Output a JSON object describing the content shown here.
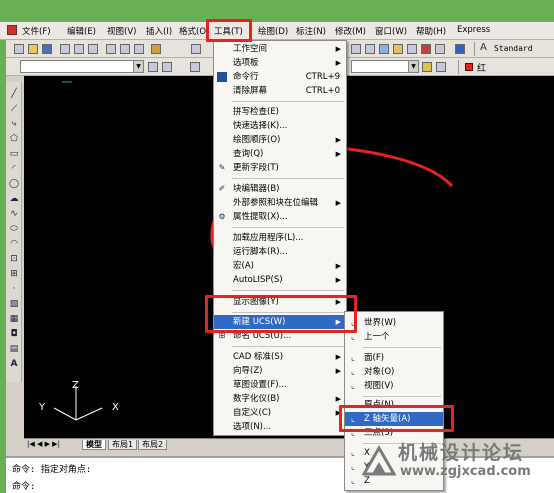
{
  "menubar": {
    "items": [
      {
        "label": "文件(F)"
      },
      {
        "label": "编辑(E)"
      },
      {
        "label": "视图(V)"
      },
      {
        "label": "插入(I)"
      },
      {
        "label": "格式(O)"
      },
      {
        "label": "工具(T)"
      },
      {
        "label": "绘图(D)"
      },
      {
        "label": "标注(N)"
      },
      {
        "label": "修改(M)"
      },
      {
        "label": "窗口(W)"
      },
      {
        "label": "帮助(H)"
      },
      {
        "label": "Express"
      }
    ]
  },
  "toolbar": {
    "style_name": "Standard",
    "layer_name": "红"
  },
  "tools_menu": {
    "items": [
      {
        "label": "工作空间",
        "sub": "▶"
      },
      {
        "label": "选项板",
        "sub": "▶"
      },
      {
        "label": "命令行",
        "shortcut": "CTRL+9"
      },
      {
        "label": "清除屏幕",
        "shortcut": "CTRL+0"
      },
      {
        "label": "拼写检查(E)"
      },
      {
        "label": "快速选择(K)..."
      },
      {
        "label": "绘图顺序(O)",
        "sub": "▶"
      },
      {
        "label": "查询(Q)",
        "sub": "▶"
      },
      {
        "label": "更新字段(T)"
      },
      {
        "label": "块编辑器(B)"
      },
      {
        "label": "外部参照和块在位编辑",
        "sub": "▶"
      },
      {
        "label": "属性提取(X)..."
      },
      {
        "label": "加载应用程序(L)..."
      },
      {
        "label": "运行脚本(R)..."
      },
      {
        "label": "宏(A)",
        "sub": "▶"
      },
      {
        "label": "AutoLISP(S)",
        "sub": "▶"
      },
      {
        "label": "显示图像(Y)",
        "sub": "▶"
      },
      {
        "label": "新建 UCS(W)",
        "sub": "▶"
      },
      {
        "label": "命名 UCS(U)..."
      },
      {
        "label": "CAD 标准(S)",
        "sub": "▶"
      },
      {
        "label": "向导(Z)",
        "sub": "▶"
      },
      {
        "label": "草图设置(F)..."
      },
      {
        "label": "数字化仪(B)",
        "sub": "▶"
      },
      {
        "label": "自定义(C)",
        "sub": "▶"
      },
      {
        "label": "选项(N)..."
      }
    ]
  },
  "ucs_menu": {
    "items": [
      {
        "label": "世界(W)"
      },
      {
        "label": "上一个"
      },
      {
        "label": "面(F)"
      },
      {
        "label": "对象(O)"
      },
      {
        "label": "视图(V)"
      },
      {
        "label": "原点(N)"
      },
      {
        "label": "Z 轴矢量(A)"
      },
      {
        "label": "三点(3)"
      },
      {
        "label": "X"
      },
      {
        "label": "Y"
      },
      {
        "label": "Z"
      }
    ]
  },
  "layout_tabs": [
    "模型",
    "布局1",
    "布局2"
  ],
  "command_line": {
    "line1": "命令: 指定对角点:",
    "line2": "命令:"
  },
  "ucs_axis": {
    "x": "X",
    "y": "Y",
    "z": "Z"
  },
  "watermark": {
    "title": "机械设计论坛",
    "url": "www.zgjxcad.com"
  },
  "colors": {
    "highlight": "#316ac5",
    "annotation_red": "#e6231f",
    "canvas": "#000000"
  }
}
